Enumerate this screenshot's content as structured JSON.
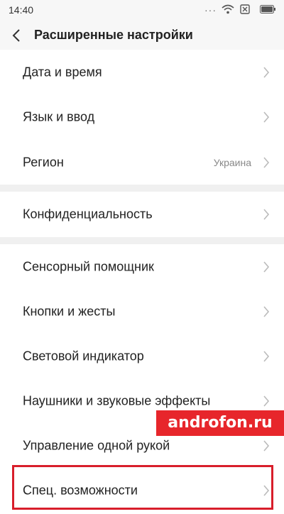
{
  "status_bar": {
    "time": "14:40",
    "dots": "···"
  },
  "header": {
    "title": "Расширенные настройки"
  },
  "sections": [
    {
      "items": [
        {
          "label": "Дата и время",
          "value": ""
        },
        {
          "label": "Язык и ввод",
          "value": ""
        },
        {
          "label": "Регион",
          "value": "Украина"
        }
      ]
    },
    {
      "items": [
        {
          "label": "Конфиденциальность",
          "value": ""
        }
      ]
    },
    {
      "items": [
        {
          "label": "Сенсорный помощник",
          "value": ""
        },
        {
          "label": "Кнопки и жесты",
          "value": ""
        },
        {
          "label": "Световой индикатор",
          "value": ""
        },
        {
          "label": "Наушники и звуковые эффекты",
          "value": ""
        },
        {
          "label": "Управление одной рукой",
          "value": ""
        },
        {
          "label": "Спец. возможности",
          "value": ""
        }
      ]
    }
  ],
  "watermark": "androfon.ru",
  "colors": {
    "highlight": "#d81e2b",
    "watermark_bg": "#e7262b"
  },
  "icons": {
    "back": "chevron-left-icon",
    "row": "chevron-right-icon"
  }
}
